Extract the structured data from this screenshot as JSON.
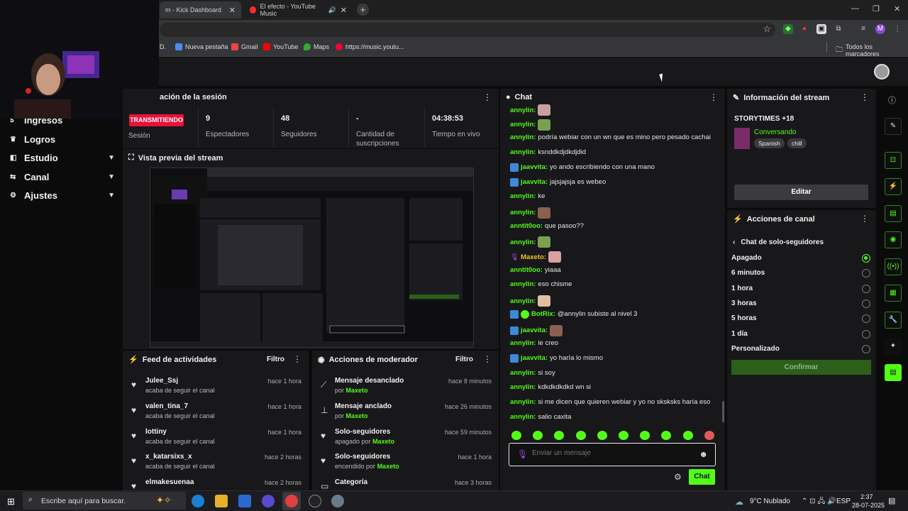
{
  "browser": {
    "tabs": [
      {
        "title": "m - Kick Dashboard"
      },
      {
        "title": "El efecto - YouTube Music"
      }
    ],
    "new_tab": "+",
    "bookmarks": [
      {
        "label": "D."
      },
      {
        "label": "Nueva pestaña"
      },
      {
        "label": "Gmail"
      },
      {
        "label": "YouTube"
      },
      {
        "label": "Maps"
      },
      {
        "label": "https://music.youtu..."
      },
      {
        "label": "Todos los marcadores"
      }
    ],
    "profile_initial": "M"
  },
  "sidebar": {
    "items": [
      {
        "label": "Ingresos",
        "icon": "dollar-icon"
      },
      {
        "label": "Logros",
        "icon": "trophy-icon"
      },
      {
        "label": "Estudio",
        "icon": "studio-icon",
        "chevron": "⌄"
      },
      {
        "label": "Canal",
        "icon": "channel-icon",
        "chevron": "⌄"
      },
      {
        "label": "Ajustes",
        "icon": "gear-icon",
        "chevron": "⌄"
      }
    ]
  },
  "session": {
    "title": "ación de la sesión",
    "live_badge": "TRANSMITIENDO",
    "session_label": "Sesión",
    "stats": [
      {
        "value": "9",
        "label": "Espectadores"
      },
      {
        "value": "48",
        "label": "Seguidores"
      },
      {
        "value": "-",
        "label": "Cantidad de suscripciones"
      },
      {
        "value": "04:38:53",
        "label": "Tiempo en vivo"
      }
    ]
  },
  "preview": {
    "title": "Vista previa del stream"
  },
  "feed": {
    "title": "Feed de actividades",
    "filter": "Filtro",
    "items": [
      {
        "name": "Julee_Ssj",
        "action": "acaba de seguir el canal",
        "time": "hace 1 hora"
      },
      {
        "name": "valen_tina_7",
        "action": "acaba de seguir el canal",
        "time": "hace 1 hora"
      },
      {
        "name": "lottiny",
        "action": "acaba de seguir el canal",
        "time": "hace 1 hora"
      },
      {
        "name": "x_katarsixs_x",
        "action": "acaba de seguir el canal",
        "time": "hace 2 horas"
      },
      {
        "name": "elmakesuenaa",
        "action": "",
        "time": "hace 2 horas"
      }
    ]
  },
  "mod": {
    "title": "Acciones de moderador",
    "filter": "Filtro",
    "items": [
      {
        "name": "Mensaje desanclado",
        "pre": "por",
        "by": "Maxeto",
        "time": "hace 8 minutos"
      },
      {
        "name": "Mensaje anclado",
        "pre": "por",
        "by": "Maxeto",
        "time": "hace 26 minutos"
      },
      {
        "name": "Solo-seguidores",
        "pre": "apagado por",
        "by": "Maxeto",
        "time": "hace 59 minutos"
      },
      {
        "name": "Solo-seguidores",
        "pre": "encendido por",
        "by": "Maxeto",
        "time": "hace 1 hora"
      },
      {
        "name": "Categoría",
        "pre": "",
        "by": "",
        "time": "hace 3 horas"
      }
    ]
  },
  "chat": {
    "title": "Chat",
    "messages": [
      {
        "user": "annylin",
        "text": "",
        "color": "#53fc18",
        "emote": true
      },
      {
        "user": "annylin",
        "text": "",
        "color": "#53fc18",
        "emote": true
      },
      {
        "user": "annylin",
        "text": "podría webiar con un wn que es mino pero pesado cachai",
        "color": "#53fc18"
      },
      {
        "user": "annylin",
        "text": "ksnddkdjdkdjdid",
        "color": "#53fc18"
      },
      {
        "user": "jaavvita",
        "text": "yo ando escribiendo con una mano",
        "color": "#53fc18",
        "badge": true
      },
      {
        "user": "jaavvita",
        "text": "jajsjajsja es webeo",
        "color": "#53fc18",
        "badge": true
      },
      {
        "user": "annylin",
        "text": "ke",
        "color": "#53fc18"
      },
      {
        "user": "annylin",
        "text": "",
        "color": "#53fc18",
        "emote": true
      },
      {
        "user": "anntit0oo",
        "text": "que pasoo??",
        "color": "#53fc18"
      },
      {
        "user": "annylin",
        "text": "",
        "color": "#53fc18",
        "emote": true
      },
      {
        "user": "Maxeto",
        "text": "",
        "color": "#f5c22b",
        "emote": true,
        "mic": true
      },
      {
        "user": "anntit0oo",
        "text": "yiaaa",
        "color": "#53fc18"
      },
      {
        "user": "annylin",
        "text": "eso chisme",
        "color": "#53fc18"
      },
      {
        "user": "annylin",
        "text": "",
        "color": "#53fc18",
        "emote": true
      },
      {
        "user": "BotRix",
        "text": "@annylin subiste al nivel 3",
        "color": "#53fc18",
        "badge": true,
        "verified": true
      },
      {
        "user": "jaavvita",
        "text": "",
        "color": "#53fc18",
        "badge": true,
        "emote": true
      },
      {
        "user": "annylin",
        "text": "le creo",
        "color": "#53fc18"
      },
      {
        "user": "jaavvita",
        "text": "yo haría lo mismo",
        "color": "#53fc18",
        "badge": true
      },
      {
        "user": "annylin",
        "text": "si soy",
        "color": "#53fc18"
      },
      {
        "user": "annylin",
        "text": "kdkdkdkdkd wn si",
        "color": "#53fc18"
      },
      {
        "user": "annylin",
        "text": "si me dicen que quieren webiar y yo no sksksks haría eso",
        "color": "#53fc18"
      },
      {
        "user": "annylin",
        "text": "salio caxita",
        "color": "#53fc18"
      }
    ],
    "placeholder": "Enviar un mensaje",
    "send_label": "Chat"
  },
  "info": {
    "title": "Información del stream",
    "stream_title": "STORYTIMES +18",
    "category": "Conversando",
    "tags": [
      "Spanish",
      "chill"
    ],
    "edit_label": "Editar"
  },
  "channel": {
    "title": "Acciones de canal",
    "back_title": "Chat de solo-seguidores",
    "options": [
      "Apagado",
      "6 minutos",
      "1 hora",
      "3 horas",
      "5 horas",
      "1 día",
      "Personalizado"
    ],
    "selected": "Apagado",
    "confirm_label": "Confirmar"
  },
  "taskbar": {
    "search": "Escribe aquí para buscar.",
    "weather": "9°C  Nublado",
    "lang": "ESP",
    "time": "2:37",
    "date": "28-07-2025"
  },
  "colors": {
    "accent": "#53fc18",
    "live": "#e9113c"
  }
}
